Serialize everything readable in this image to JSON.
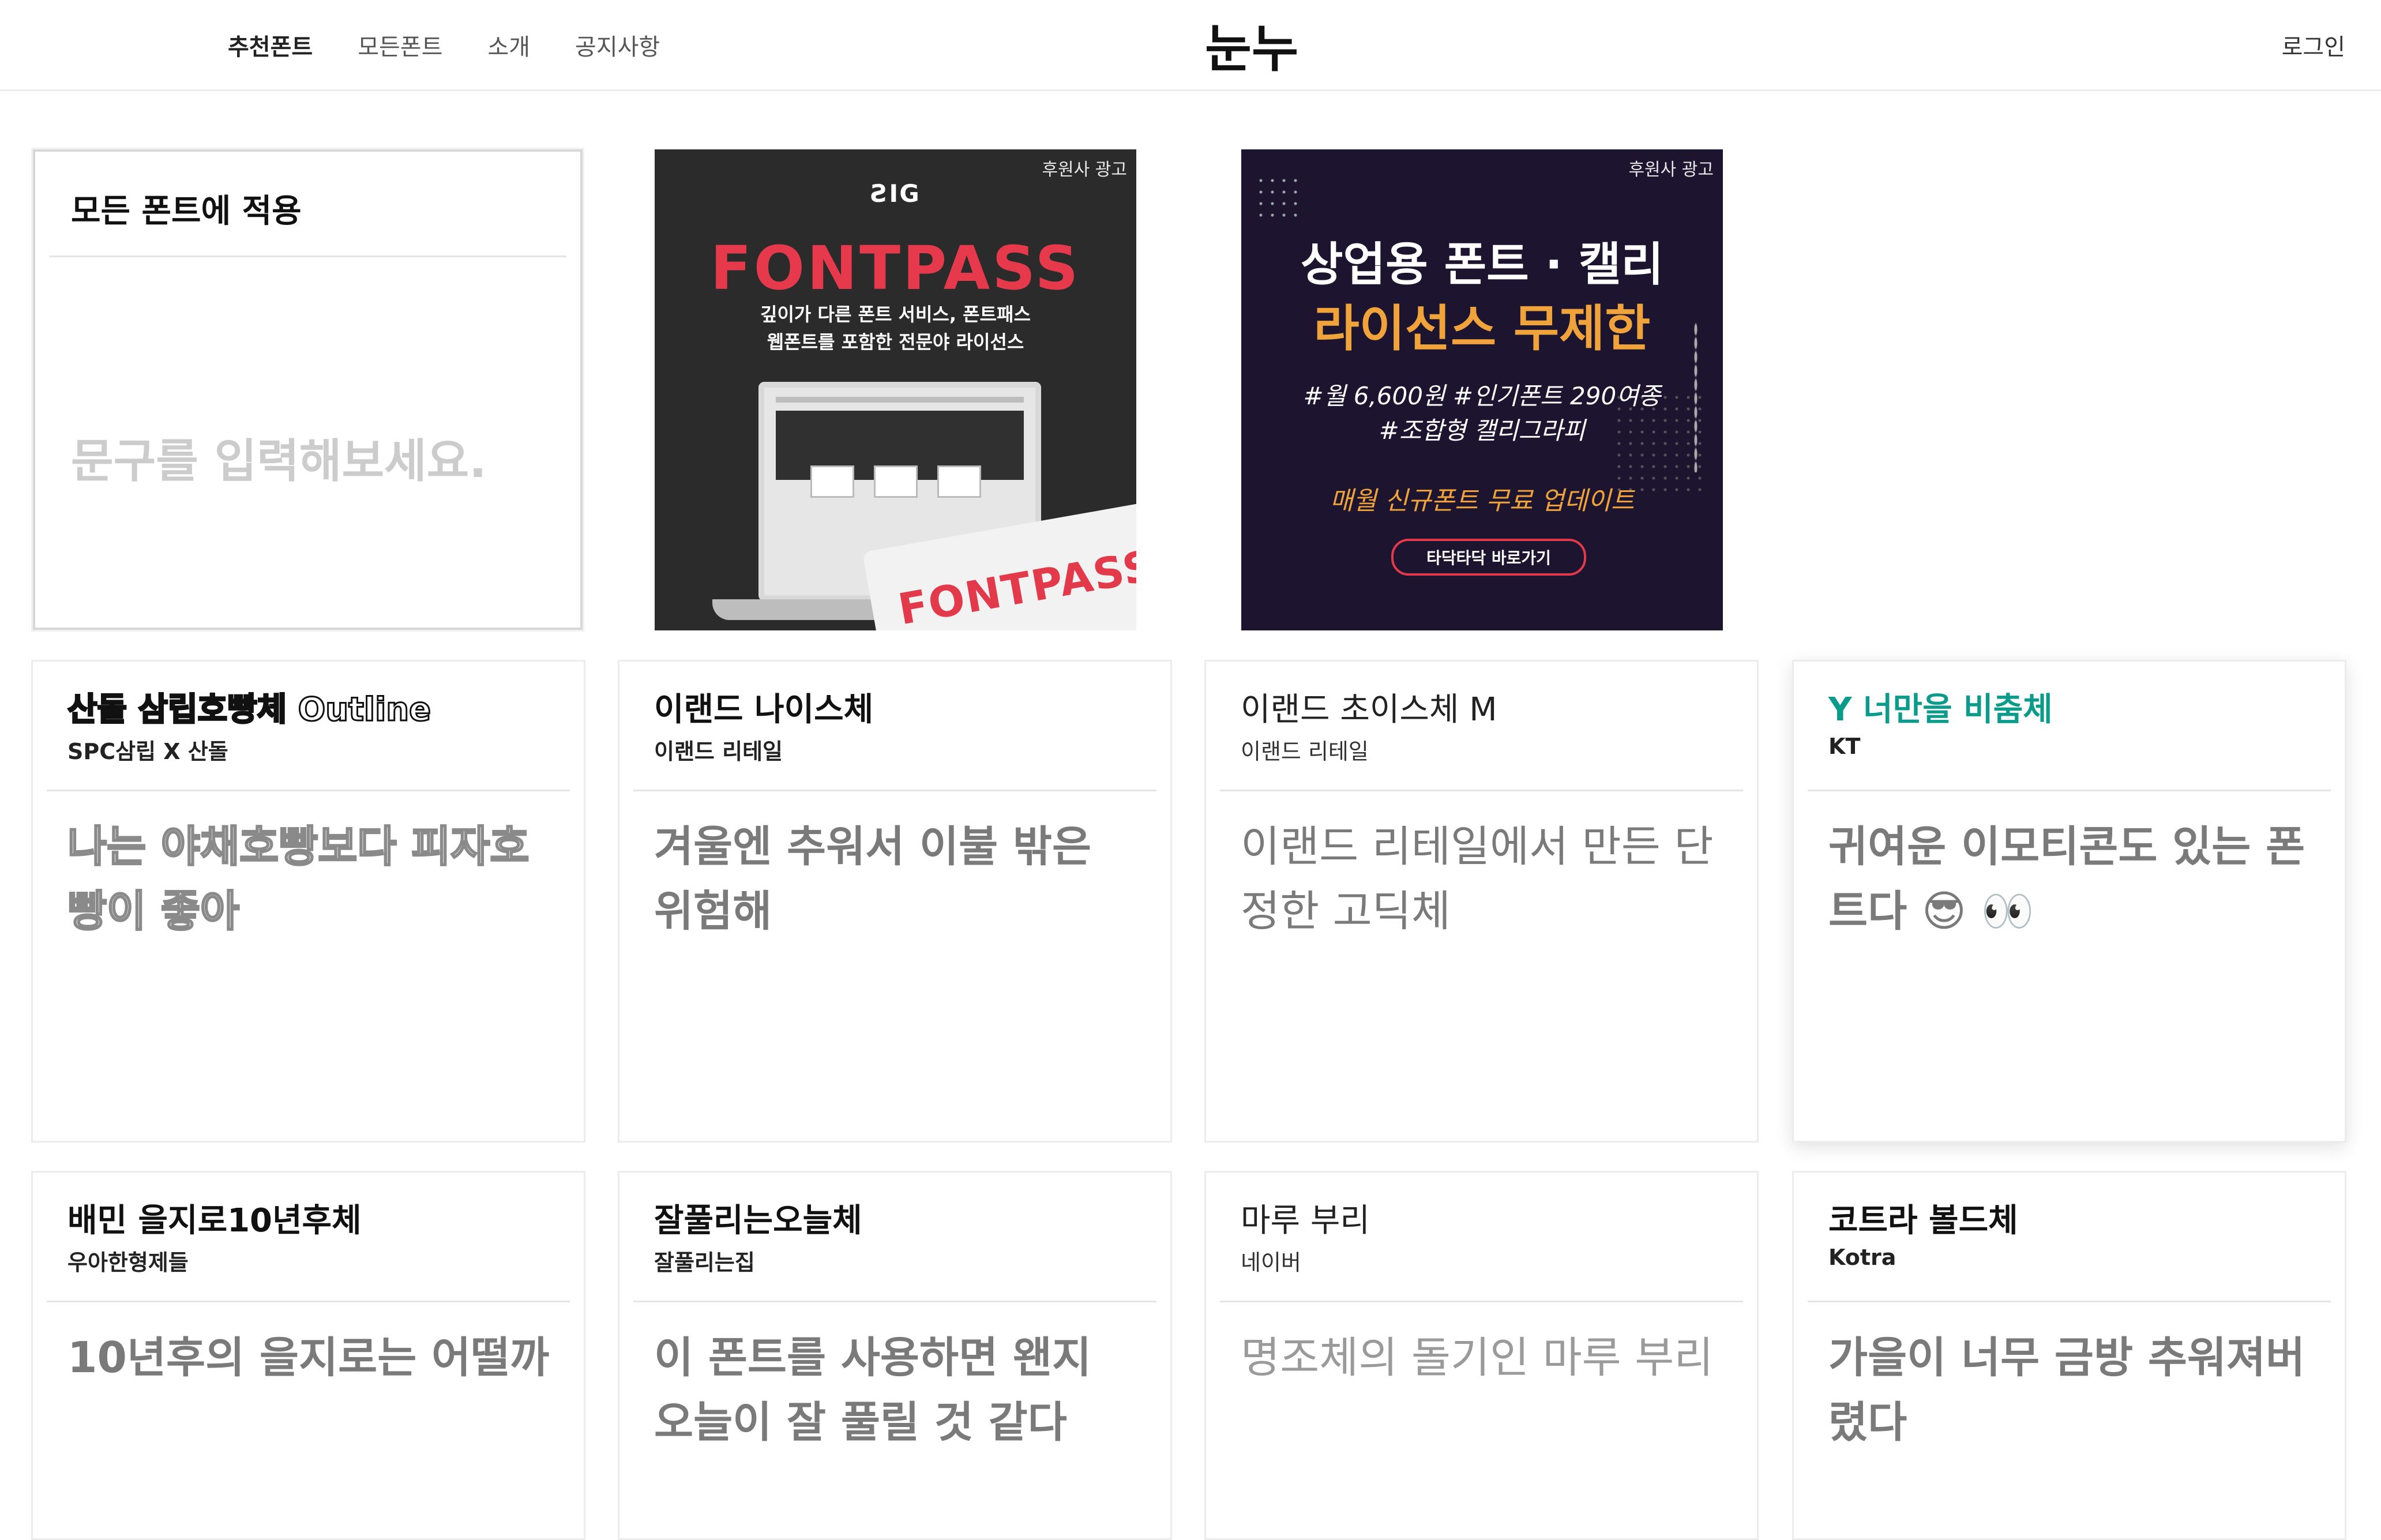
{
  "header": {
    "nav": [
      "추천폰트",
      "모든폰트",
      "소개",
      "공지사항"
    ],
    "logo": "눈누",
    "login": "로그인"
  },
  "apply_card": {
    "title": "모든 폰트에 적용",
    "placeholder": "문구를 입력해보세요."
  },
  "ads": [
    {
      "badge": "후원사 광고",
      "brand": "ƧIG",
      "title": "FONTPASS",
      "subtitle_line1": "깊이가 다른 폰트 서비스, 폰트패스",
      "subtitle_line2": "웹폰트를 포함한 전문야 라이선스",
      "ticket_text": "FONTPASS"
    },
    {
      "badge": "후원사 광고",
      "title_line1": "상업용 폰트 · 캘리",
      "title_line2": "라이선스 무제한",
      "tags_line1": "#월 6,600원 #인기폰트 290여종",
      "tags_line2": "#조합형 캘리그라피",
      "promo": "매월 신규폰트 무료 업데이트",
      "button": "타닥타닥 바로가기",
      "controls": "► ► ►"
    }
  ],
  "fonts": [
    {
      "title": "산돌 삼립호빵체 Outline",
      "maker": "SPC삼립 X 산돌",
      "sample": "나는 야채호빵보다 피자호빵이 좋아"
    },
    {
      "title": "이랜드 나이스체",
      "maker": "이랜드 리테일",
      "sample": "겨울엔 추워서 이불 밖은 위험해"
    },
    {
      "title": "이랜드 초이스체 M",
      "maker": "이랜드 리테일",
      "sample": "이랜드 리테일에서 만든 단정한 고딕체"
    },
    {
      "title": "Y 너만을 비춤체",
      "maker": "KT",
      "sample": "귀여운 이모티콘도 있는 폰트다 😎 👀"
    },
    {
      "title": "배민 을지로10년후체",
      "maker": "우아한형제들",
      "sample": "10년후의 을지로는 어떨까"
    },
    {
      "title": "잘풀리는오늘체",
      "maker": "잘풀리는집",
      "sample": "이 폰트를 사용하면 왠지 오늘이 잘 풀릴 것 같다"
    },
    {
      "title": "마루 부리",
      "maker": "네이버",
      "sample": "명조체의 돌기인 마루 부리"
    },
    {
      "title": "코트라 볼드체",
      "maker": "Kotra",
      "sample": "가을이 너무 금방 추워져버렸다"
    }
  ],
  "colors": {
    "accent_teal": "#0a9b8b",
    "fontpass_red": "#e63a4c",
    "ad2_gold": "#f0a33b",
    "ad2_bg": "#1d1530"
  }
}
